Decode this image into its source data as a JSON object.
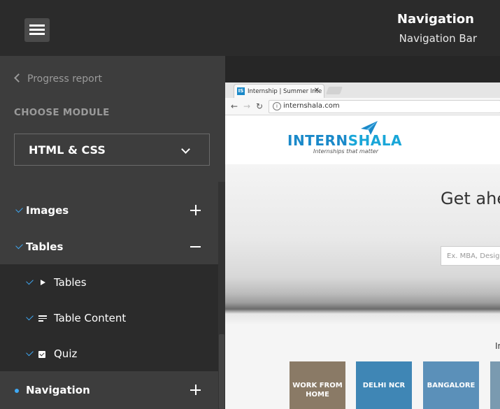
{
  "header": {
    "title": "Navigation",
    "subtitle": "Navigation Bar"
  },
  "sidebar": {
    "back_label": "Progress report",
    "choose_label": "CHOOSE MODULE",
    "module_value": "HTML & CSS",
    "items": [
      {
        "label": "Images",
        "state": "complete",
        "toggle": "plus"
      },
      {
        "label": "Tables",
        "state": "complete",
        "toggle": "minus"
      },
      {
        "label": "Navigation",
        "state": "current",
        "toggle": "plus"
      }
    ],
    "subitems": [
      {
        "label": "Tables",
        "icon": "play-icon"
      },
      {
        "label": "Table Content",
        "icon": "text-icon"
      },
      {
        "label": "Quiz",
        "icon": "quiz-icon"
      }
    ]
  },
  "browser": {
    "tab_title": "Internship | Summer Inte",
    "favicon": "IS",
    "close": "✕",
    "url": "internshala.com",
    "brand_a": "INTERN",
    "brand_b": "SHALA",
    "tagline": "Internships that matter",
    "hero_text": "Get ahead",
    "search_placeholder": "Ex. MBA, Design,",
    "section_text": "In",
    "cards": [
      "WORK FROM HOME",
      "DELHI NCR",
      "BANGALORE"
    ]
  },
  "colors": {
    "accent": "#3fa9f5",
    "sidebar": "#3d3d3d",
    "dark": "#2b2b2b"
  }
}
